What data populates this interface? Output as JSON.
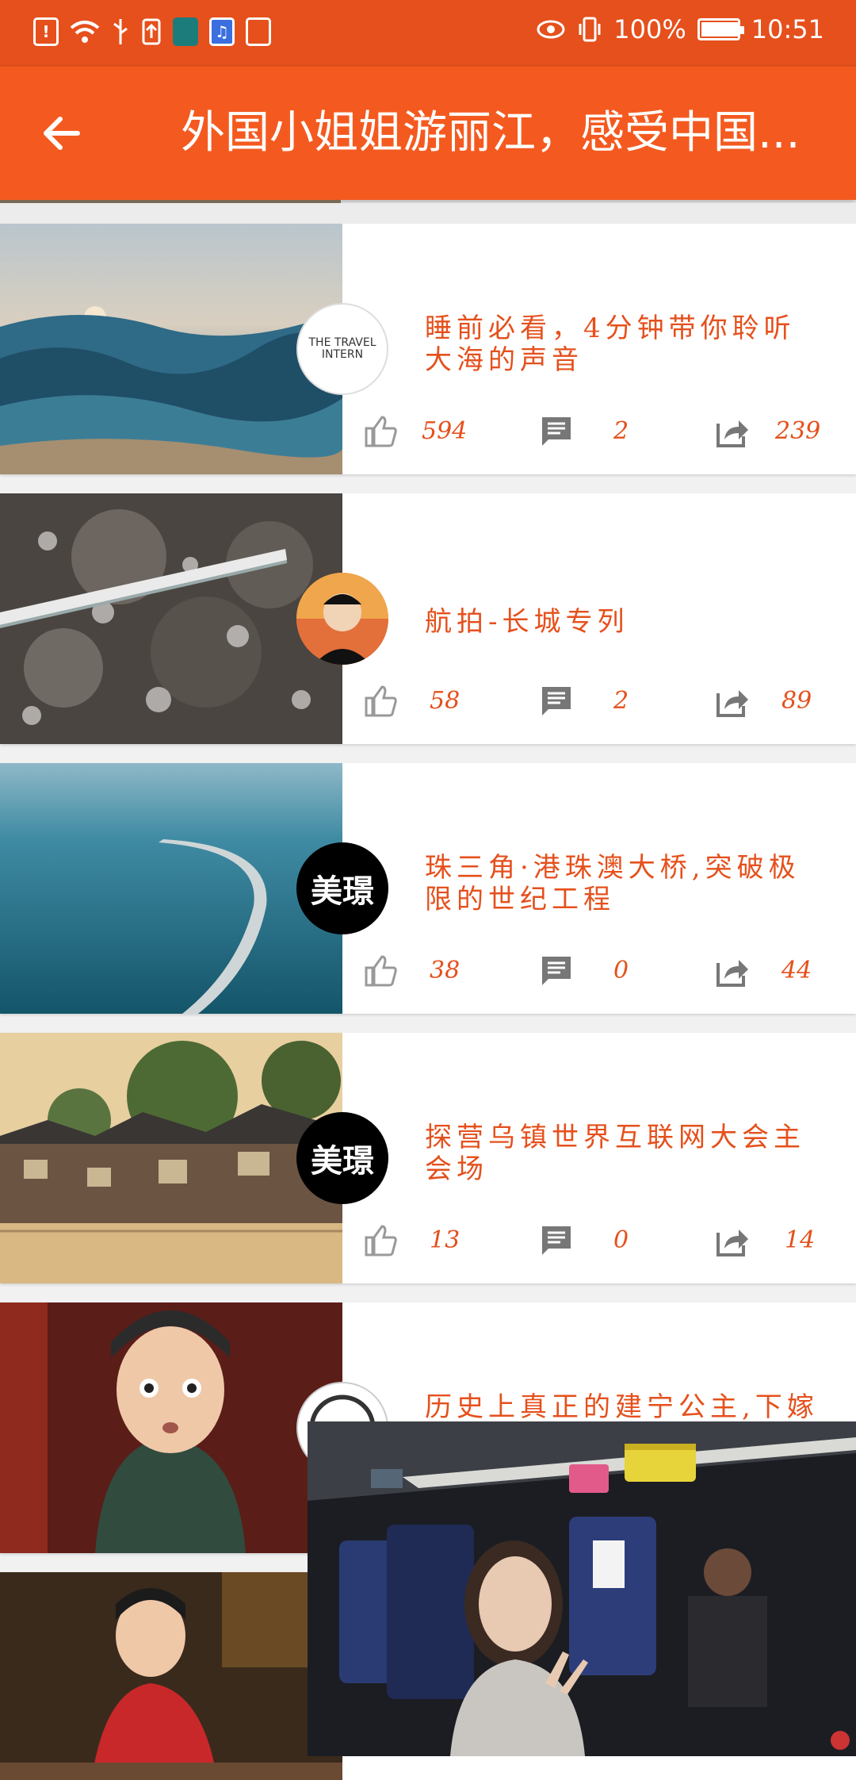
{
  "status_bar": {
    "battery_level": "100%",
    "time": "10:51",
    "battery_fraction": 1.0
  },
  "app_bar": {
    "title": "外国小姐姐游丽江，感受中国...",
    "back_icon": "arrow-left-icon"
  },
  "colors": {
    "accent": "#f45a1f",
    "status_bar": "#e5501c",
    "text_accent": "#e5501c"
  },
  "feed": {
    "items": [
      {
        "title": "睡前必看，4分钟带你聆听大海的声音",
        "avatar": "THE TRAVEL INTERN",
        "likes": "594",
        "comments": "2",
        "shares": "239"
      },
      {
        "title": "航拍-长城专列",
        "likes": "58",
        "comments": "2",
        "shares": "89"
      },
      {
        "title": "珠三角·港珠澳大桥,突破极限的世纪工程",
        "avatar": "美璟",
        "likes": "38",
        "comments": "0",
        "shares": "44"
      },
      {
        "title": "探营乌镇世界互联网大会主会场",
        "avatar": "美璟",
        "likes": "13",
        "comments": "0",
        "shares": "14"
      },
      {
        "title": "历史上真正的建宁公主,下嫁",
        "likes": "",
        "comments": "",
        "shares": ""
      },
      {
        "title": "",
        "likes": "",
        "comments": "",
        "shares": ""
      }
    ]
  },
  "icons": {
    "like": "thumb-up-icon",
    "comment": "comment-icon",
    "share": "share-icon"
  }
}
